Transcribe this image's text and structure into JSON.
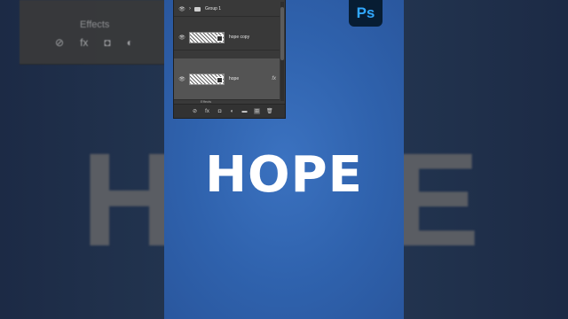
{
  "brand": {
    "app_badge": "Ps",
    "badge_color": "#31A8FF"
  },
  "canvas": {
    "headline": "HOPE",
    "ghost_headline": "HOPE"
  },
  "layers_panel": {
    "group": {
      "label": "Group 1",
      "visible": true
    },
    "rows": [
      {
        "label": "hope copy",
        "visible": true,
        "selected": false,
        "has_fx": false
      },
      {
        "label": "hope",
        "visible": true,
        "selected": true,
        "has_fx": true
      }
    ],
    "fx_symbol": "fx",
    "effects_label": "Effects",
    "tools": [
      {
        "name": "link-layers-icon",
        "glyph": "⊘"
      },
      {
        "name": "add-layer-style-icon",
        "glyph": "fx"
      },
      {
        "name": "add-mask-icon",
        "glyph": "◘"
      },
      {
        "name": "adjustment-layer-icon",
        "glyph": "◐"
      },
      {
        "name": "new-group-icon",
        "glyph": "▬"
      },
      {
        "name": "new-layer-icon",
        "glyph": "⊞"
      },
      {
        "name": "delete-layer-icon",
        "glyph": "🗑"
      }
    ]
  },
  "ghost_panel": {
    "effects_label": "Effects",
    "fx_symbol": "fx"
  }
}
